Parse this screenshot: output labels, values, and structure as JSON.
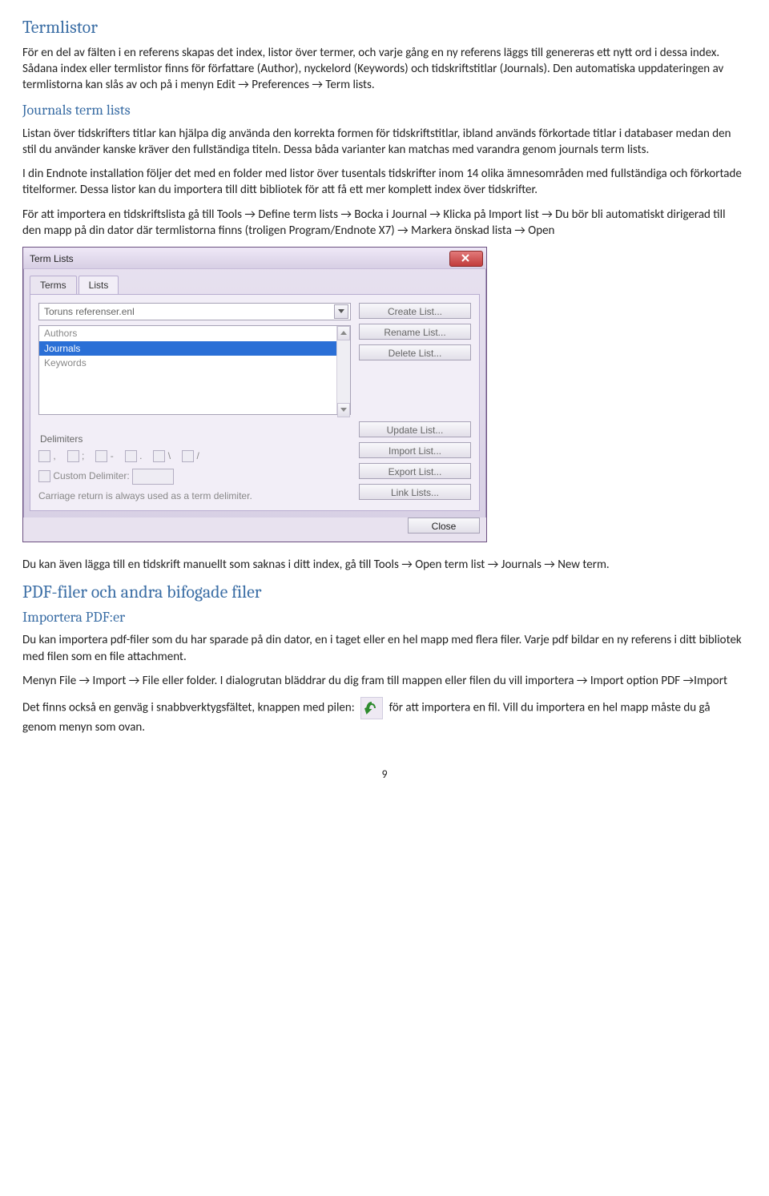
{
  "h1_termlistor": "Termlistor",
  "p1": "För en del av fälten i en referens skapas det index, listor över termer, och varje gång en ny referens läggs till genereras ett nytt ord i dessa index. Sådana index eller termlistor finns för författare (Author), nyckelord (Keywords) och tidskriftstitlar (Journals). Den automatiska uppdateringen av termlistorna kan slås av och på i menyn Edit → Preferences → Term lists.",
  "h2_journals": "Journals term lists",
  "p2": "Listan över tidskrifters titlar kan hjälpa dig använda den korrekta formen för tidskriftstitlar, ibland används förkortade titlar i databaser medan den stil du använder kanske kräver den fullständiga titeln. Dessa båda varianter kan matchas med varandra genom journals term lists.",
  "p3": "I din Endnote installation följer det med en folder med listor över tusentals tidskrifter inom 14 olika ämnesområden med fullständiga och förkortade titelformer. Dessa listor kan du importera till ditt bibliotek för att få ett mer komplett index över tidskrifter.",
  "p4": "För att importera en tidskriftslista gå till Tools → Define term lists → Bocka i Journal → Klicka på Import list → Du bör bli automatiskt dirigerad till den mapp på din dator där termlistorna finns (troligen Program/Endnote X7) → Markera önskad lista → Open",
  "dialog": {
    "title": "Term Lists",
    "tab_terms": "Terms",
    "tab_lists": "Lists",
    "combo_value": "Toruns referenser.enl",
    "list_items": [
      "Authors",
      "Journals",
      "Keywords"
    ],
    "selected_index": 1,
    "buttons": {
      "create": "Create List...",
      "rename": "Rename List...",
      "delete": "Delete List...",
      "update": "Update List...",
      "import": "Import List...",
      "export": "Export List...",
      "link": "Link Lists..."
    },
    "section_delimiters": "Delimiters",
    "delims": [
      ",",
      ";",
      "-",
      ".",
      "\\",
      "/"
    ],
    "custom_label": "Custom Delimiter:",
    "note": "Carriage return is always used as a term delimiter.",
    "close": "Close"
  },
  "p5": "Du kan även lägga till en tidskrift manuellt som saknas i ditt index, gå till Tools → Open term list → Journals → New term.",
  "h1_pdf": "PDF-filer och andra bifogade filer",
  "h2_import": "Importera PDF:er",
  "p6": "Du kan importera pdf-filer som du har sparade på din dator, en i taget eller en hel mapp med flera filer. Varje pdf bildar en ny referens i ditt bibliotek med filen som en file attachment.",
  "p7": "Menyn File → Import → File eller folder. I dialogrutan bläddrar du dig fram till mappen eller filen du vill importera → Import option PDF →Import",
  "p8a": "Det finns också en genväg i snabbverktygsfältet, knappen med pilen:",
  "p8b": "för att importera en fil. Vill du importera en hel mapp måste du gå genom menyn som ovan.",
  "page_number": "9"
}
